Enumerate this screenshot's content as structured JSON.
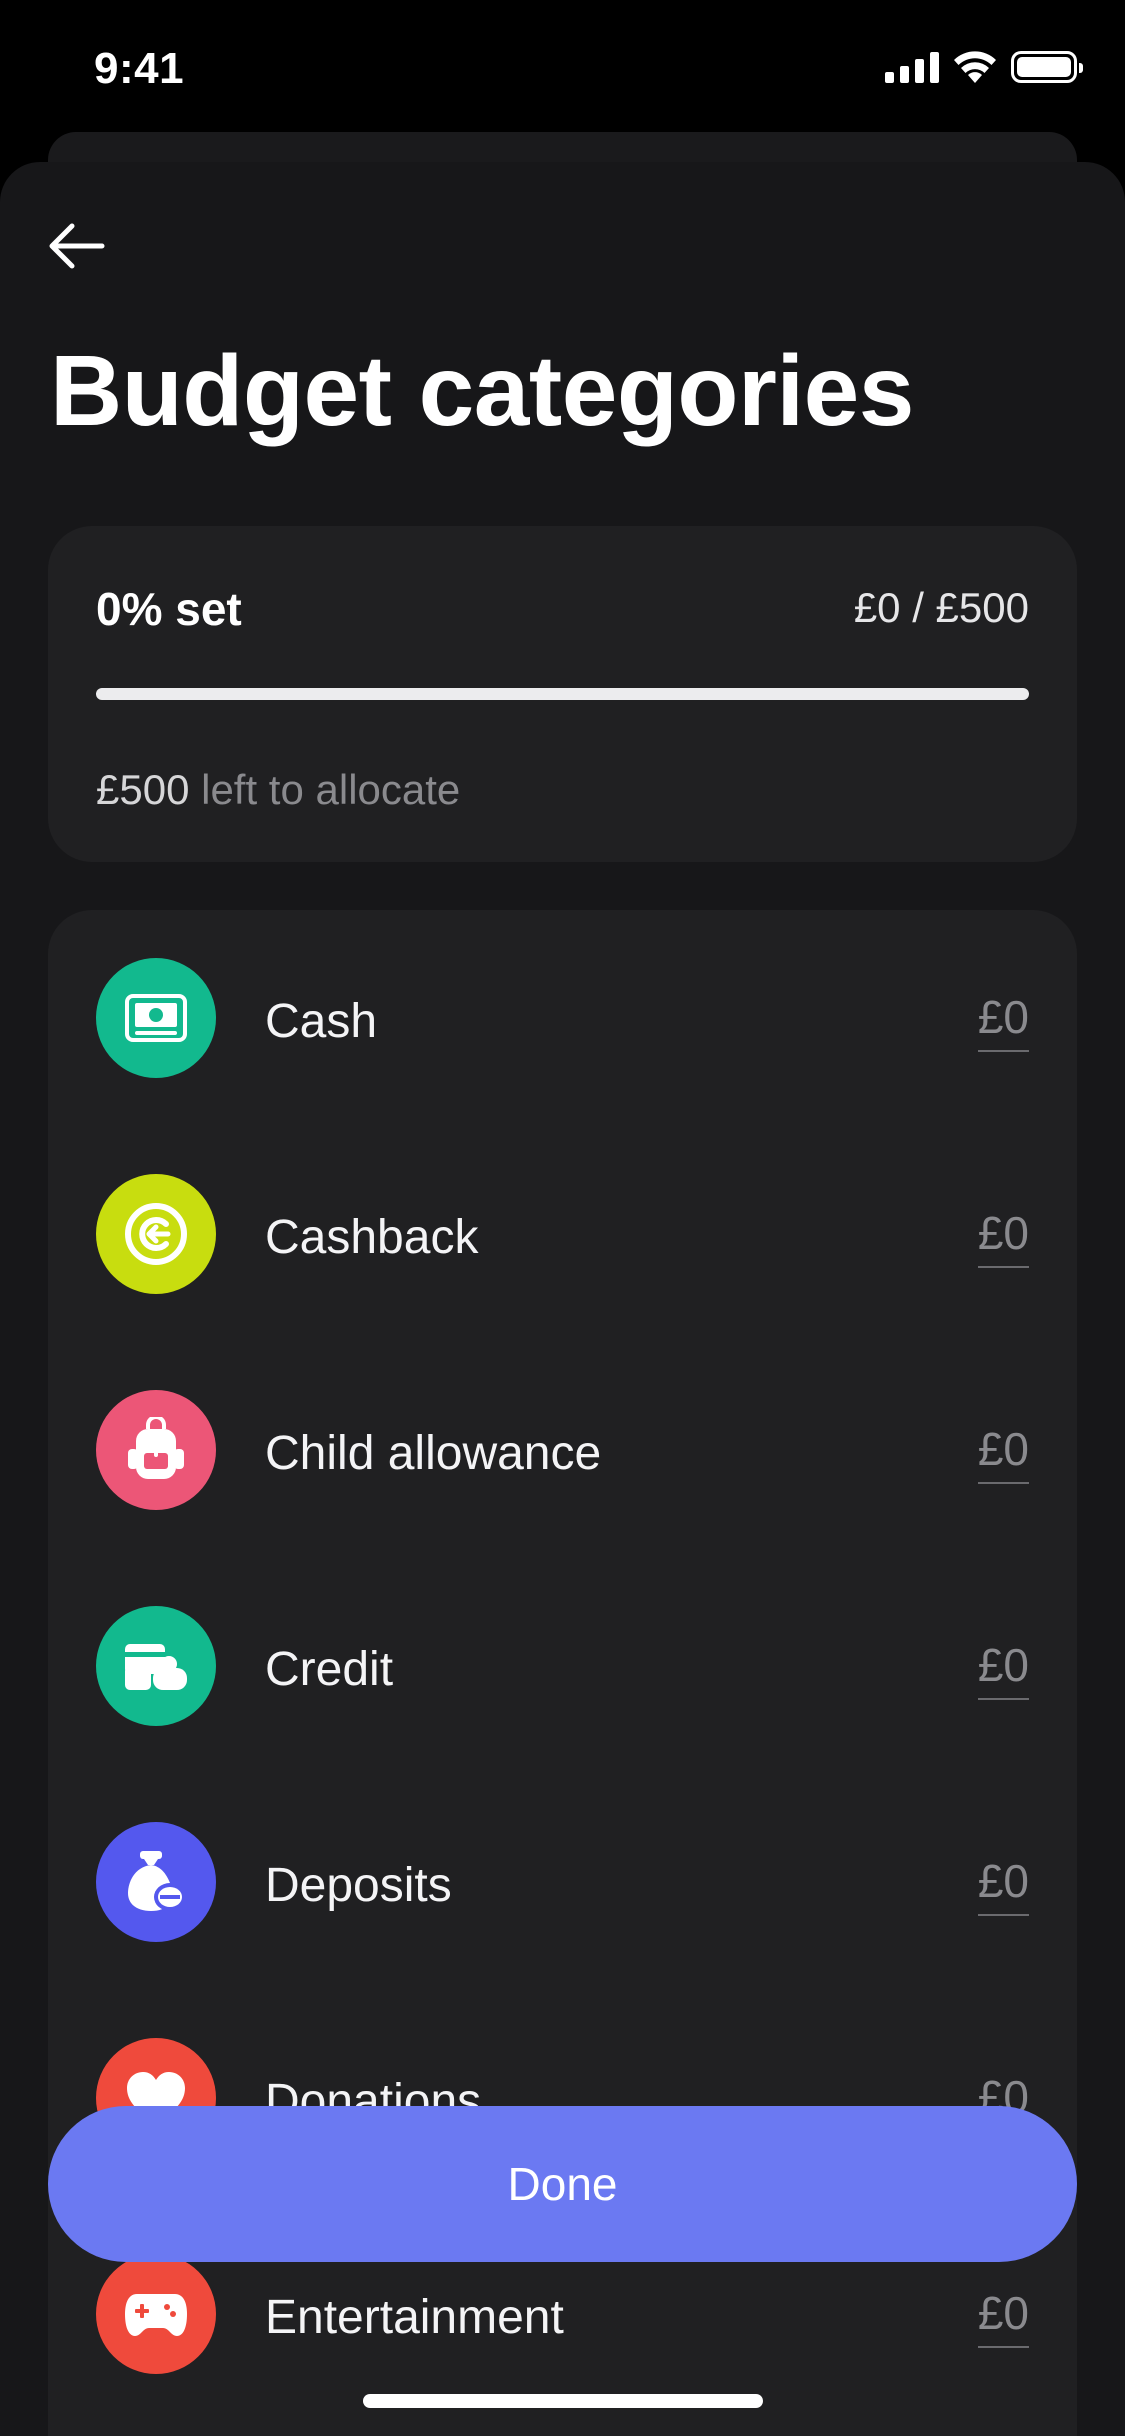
{
  "status_bar": {
    "time": "9:41"
  },
  "header": {
    "title": "Budget categories"
  },
  "summary": {
    "percent_set_label": "0% set",
    "allocated_of_total": "£0 / £500",
    "progress": 0,
    "left_amount": "£500",
    "left_text": "left to allocate"
  },
  "categories": [
    {
      "label": "Cash",
      "amount": "£0",
      "icon": "cash-icon",
      "color": "#12b98e"
    },
    {
      "label": "Cashback",
      "amount": "£0",
      "icon": "cashback-icon",
      "color": "#c8dd0f"
    },
    {
      "label": "Child allowance",
      "amount": "£0",
      "icon": "backpack-icon",
      "color": "#ec5677"
    },
    {
      "label": "Credit",
      "amount": "£0",
      "icon": "credit-icon",
      "color": "#12b98e"
    },
    {
      "label": "Deposits",
      "amount": "£0",
      "icon": "money-bag-icon",
      "color": "#5458ee"
    },
    {
      "label": "Donations",
      "amount": "£0",
      "icon": "heart-icon",
      "color": "#ef4a3c"
    },
    {
      "label": "Entertainment",
      "amount": "£0",
      "icon": "gamepad-icon",
      "color": "#ef4a3c"
    }
  ],
  "done_label": "Done",
  "colors": {
    "accent": "#6b79f2",
    "background": "#171719",
    "card": "#202022"
  }
}
